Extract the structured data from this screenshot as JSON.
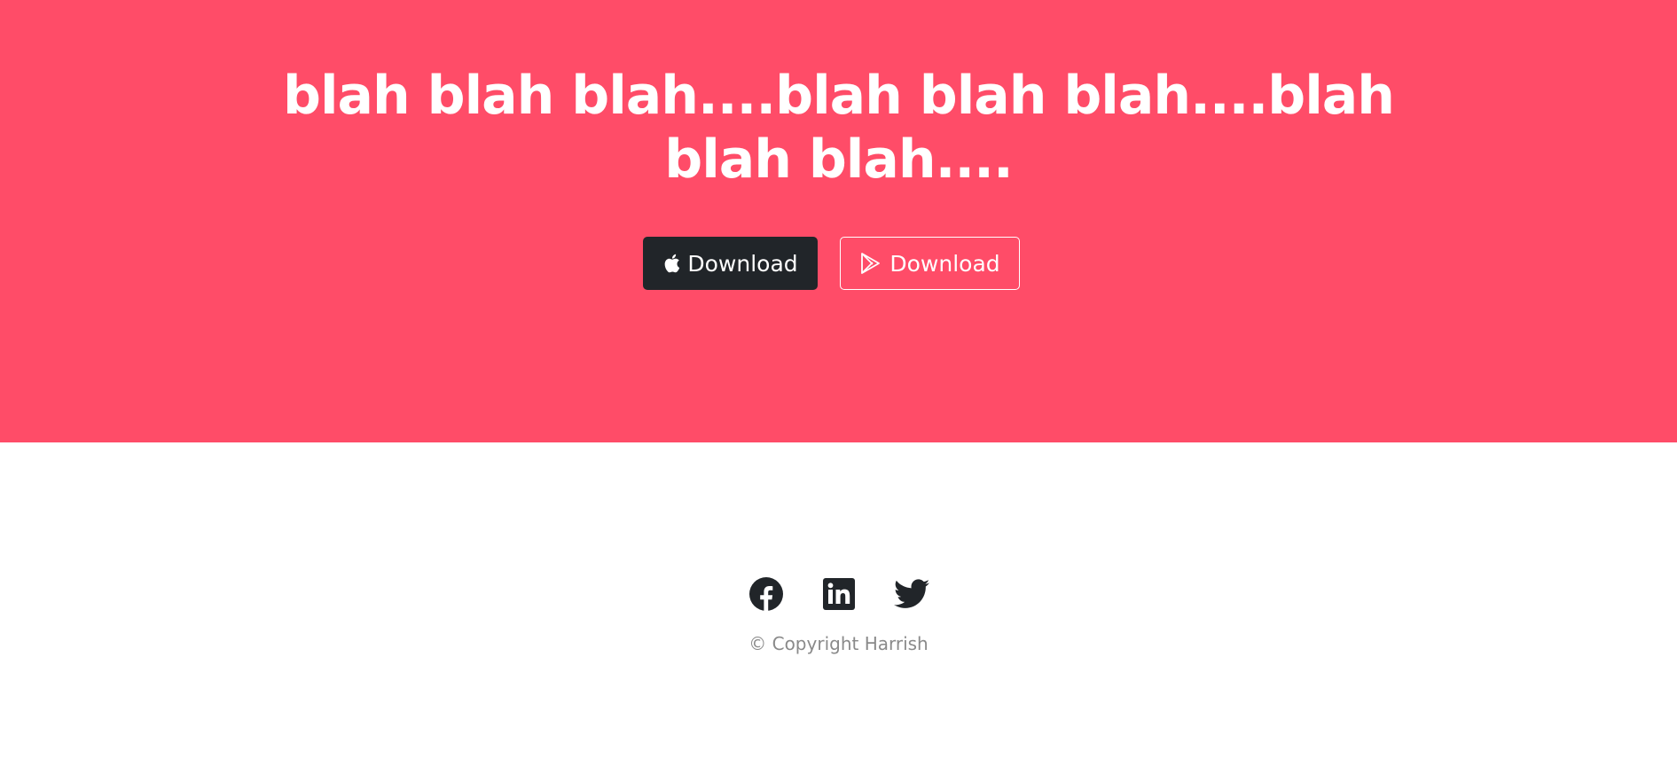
{
  "hero": {
    "headline_line1": "blah blah blah....blah blah blah....blah",
    "headline_line2": "blah blah....",
    "background_color": "#ff4c68"
  },
  "buttons": {
    "apple": {
      "label": "Download",
      "icon": "apple-icon",
      "color": "#212529"
    },
    "play": {
      "label": "Download",
      "icon": "google-play-icon"
    }
  },
  "footer": {
    "social": [
      {
        "name": "facebook",
        "icon": "facebook-icon"
      },
      {
        "name": "linkedin",
        "icon": "linkedin-icon"
      },
      {
        "name": "twitter",
        "icon": "twitter-icon"
      }
    ],
    "icon_color": "#212529",
    "copyright": "© Copyright Harrish"
  }
}
